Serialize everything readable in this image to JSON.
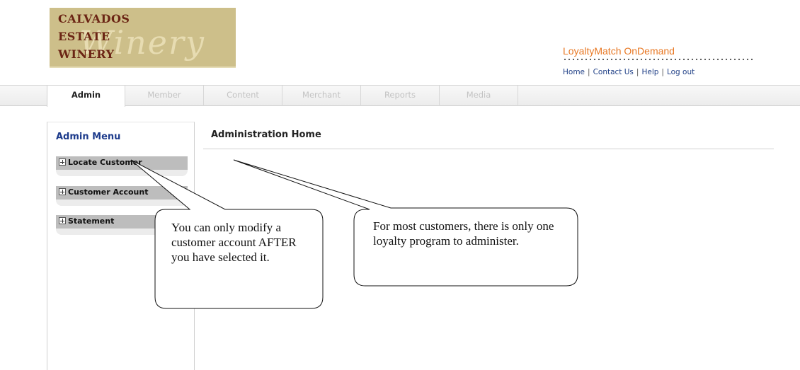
{
  "logo": {
    "line1": "CALVADOS",
    "line2": "ESTATE",
    "line3": "WINERY",
    "script": "Winery"
  },
  "brand": {
    "name": "LoyaltyMatch OnDemand",
    "accent_color": "#e87722"
  },
  "top_links": [
    {
      "label": "Home"
    },
    {
      "label": "Contact Us"
    },
    {
      "label": "Help"
    },
    {
      "label": "Log out"
    }
  ],
  "tabs": [
    {
      "label": "Admin",
      "active": true
    },
    {
      "label": "Member",
      "active": false
    },
    {
      "label": "Content",
      "active": false
    },
    {
      "label": "Merchant",
      "active": false
    },
    {
      "label": "Reports",
      "active": false
    },
    {
      "label": "Media",
      "active": false
    }
  ],
  "sidebar": {
    "title": "Admin Menu",
    "items": [
      {
        "label": "Locate Customer",
        "icon": "plus-icon"
      },
      {
        "label": "Customer Account",
        "icon": "plus-icon"
      },
      {
        "label": "Statement",
        "icon": "plus-icon"
      }
    ]
  },
  "main": {
    "title": "Administration Home"
  },
  "callouts": [
    {
      "text": "You can only modify a customer account AFTER you have selected it."
    },
    {
      "text": "For most customers, there is only one loyalty program to administer."
    }
  ]
}
